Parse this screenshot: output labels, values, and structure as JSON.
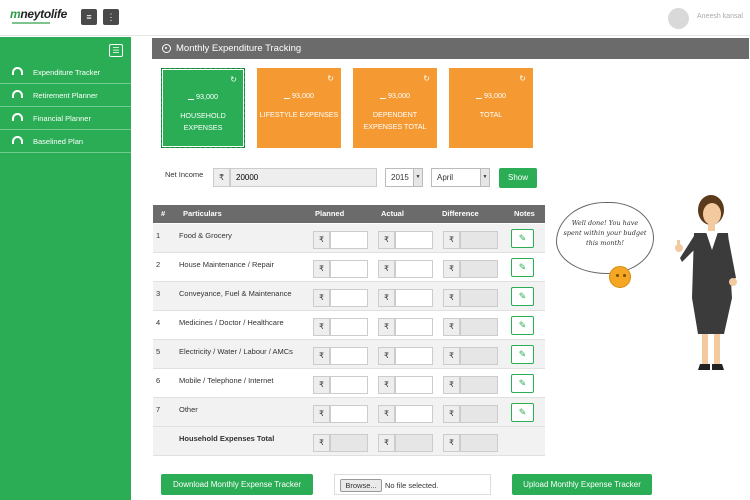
{
  "header": {
    "logo_part1": "m",
    "logo_part2": "neytolife",
    "user_name": "Aneesh kansal"
  },
  "sidebar": {
    "items": [
      {
        "label": "Expenditure Tracker"
      },
      {
        "label": "Retirement Planner"
      },
      {
        "label": "Financial Planner"
      },
      {
        "label": "Baselined Plan"
      }
    ]
  },
  "panel": {
    "title": "Monthly Expenditure Tracking"
  },
  "cards": [
    {
      "amount": "93,000",
      "label": "HOUSEHOLD EXPENSES",
      "color": "#2aad55"
    },
    {
      "amount": "93,000",
      "label": "LIFESTYLE EXPENSES",
      "color": "#f59a33"
    },
    {
      "amount": "93,000",
      "label": "DEPENDENT EXPENSES TOTAL",
      "color": "#f59a33"
    },
    {
      "amount": "93,000",
      "label": "TOTAL",
      "color": "#f59a33"
    }
  ],
  "filters": {
    "net_income_label": "Net Income",
    "currency": "₹",
    "net_income": "20000",
    "year": "2015",
    "month": "April",
    "show": "Show"
  },
  "table": {
    "headers": {
      "num": "#",
      "particulars": "Particulars",
      "planned": "Planned",
      "actual": "Actual",
      "difference": "Difference",
      "notes": "Notes"
    },
    "rows": [
      {
        "num": "1",
        "particulars": "Food & Grocery"
      },
      {
        "num": "2",
        "particulars": "House Maintenance / Repair"
      },
      {
        "num": "3",
        "particulars": "Conveyance, Fuel & Maintenance"
      },
      {
        "num": "4",
        "particulars": "Medicines / Doctor / Healthcare"
      },
      {
        "num": "5",
        "particulars": "Electricity / Water / Labour / AMCs"
      },
      {
        "num": "6",
        "particulars": "Mobile / Telephone / Internet"
      },
      {
        "num": "7",
        "particulars": "Other"
      }
    ],
    "total_label": "Household Expenses Total"
  },
  "footer": {
    "download": "Download Monthly Expense Tracker",
    "browse": "Browse...",
    "file_status": "No file selected.",
    "upload": "Upload Monthly Expense Tracker"
  },
  "speech": {
    "text": "Well done! You have spent within your budget this month!"
  },
  "icons": {
    "refresh": "refresh-icon",
    "bars": "bar-chart-icon",
    "edit": "pencil-icon",
    "menu": "hamburger-icon",
    "more": "vertical-ellipsis-icon",
    "dashboard": "dashboard-icon"
  }
}
